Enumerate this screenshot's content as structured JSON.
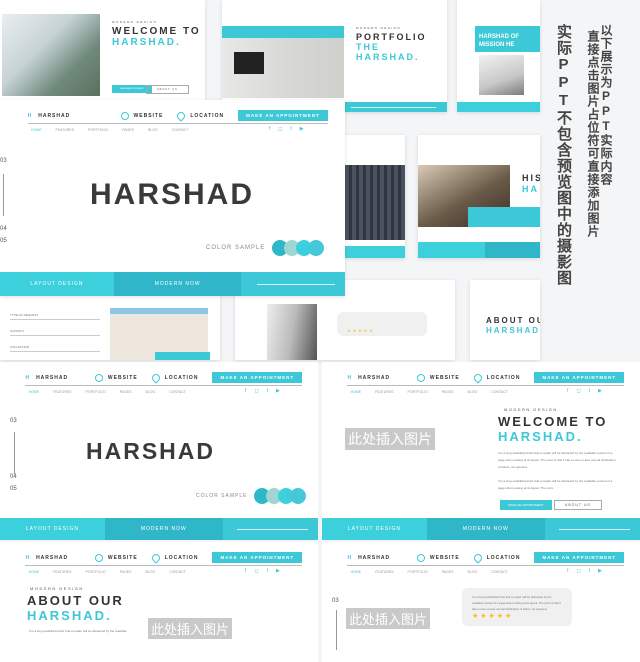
{
  "brand": "HARSHAD",
  "logo_mark": "H",
  "header": {
    "website": "WEBSITE",
    "location": "LOCATION",
    "appointment": "MAKE AN APPOINTMENT"
  },
  "nav": [
    "HOME",
    "FEATURES",
    "PORTFOLIO",
    "PAGES",
    "BLOG",
    "CONTACT"
  ],
  "social": [
    "f",
    "◻",
    "t",
    "▶"
  ],
  "footer": {
    "left": "LAYOUT DESIGN",
    "middle": "MODERN NOW"
  },
  "colors": {
    "accent": "#3cc8d6",
    "accent_dark": "#2fb6c9",
    "text": "#333333",
    "palette": [
      "#2fb6c9",
      "#9fd6d3",
      "#3cd0dc",
      "#46c8da"
    ]
  },
  "placeholder": "此处插入图片",
  "side_text": {
    "main": "实际PPT不包含预览图中的摄影图",
    "sub1": "以下展示为PPT实际内容",
    "sub2": "直接点击图片占位符可直接添加图片"
  },
  "slides": {
    "cover": {
      "title": "HARSHAD",
      "numbers": [
        "03",
        "04",
        "05"
      ],
      "color_sample": "COLOR SAMPLE"
    },
    "welcome": {
      "tag": "MODERN DESIGN",
      "line1": "WELCOME TO",
      "line2": "HARSHAD.",
      "para1": "It is a long established fact that a reader will be distracted by the readable content of a page when looking at its layout. The point is that it has a more-or-less normal distribution of letters, as opposed.",
      "para2": "It is a long established fact that a reader will be distracted by the readable content of a page when looking at its layout. The point.",
      "btn1": "MAKE AN APPOINTMENT",
      "btn2": "ABOUT US"
    },
    "portfolio": {
      "tag": "MODERN DESIGN",
      "line1": "PORTFOLIO",
      "line2": "THE HARSHAD."
    },
    "mission": {
      "line1": "HARSHAD OF",
      "line2": "MISSION HE"
    },
    "history": {
      "line1": "HIS",
      "line2": "HA"
    },
    "contact": {
      "fields": [
        "TYPE OF REQUEST",
        "CONTACT",
        "COLLECTION"
      ]
    },
    "about": {
      "tag": "MODERN DESIGN",
      "line1": "ABOUT OUR",
      "line2": "HARSHAD.",
      "para": "It is a long established fact that a reader will be distracted by the readable"
    },
    "testimonial": {
      "number": "03",
      "quote": "It is a long established fact that a reader will be distracted by the readable content of a page when looking at its layout. The point is that it has a more-or-less normal distribution of letters, as opposed.",
      "stars": "★★★★★"
    }
  }
}
